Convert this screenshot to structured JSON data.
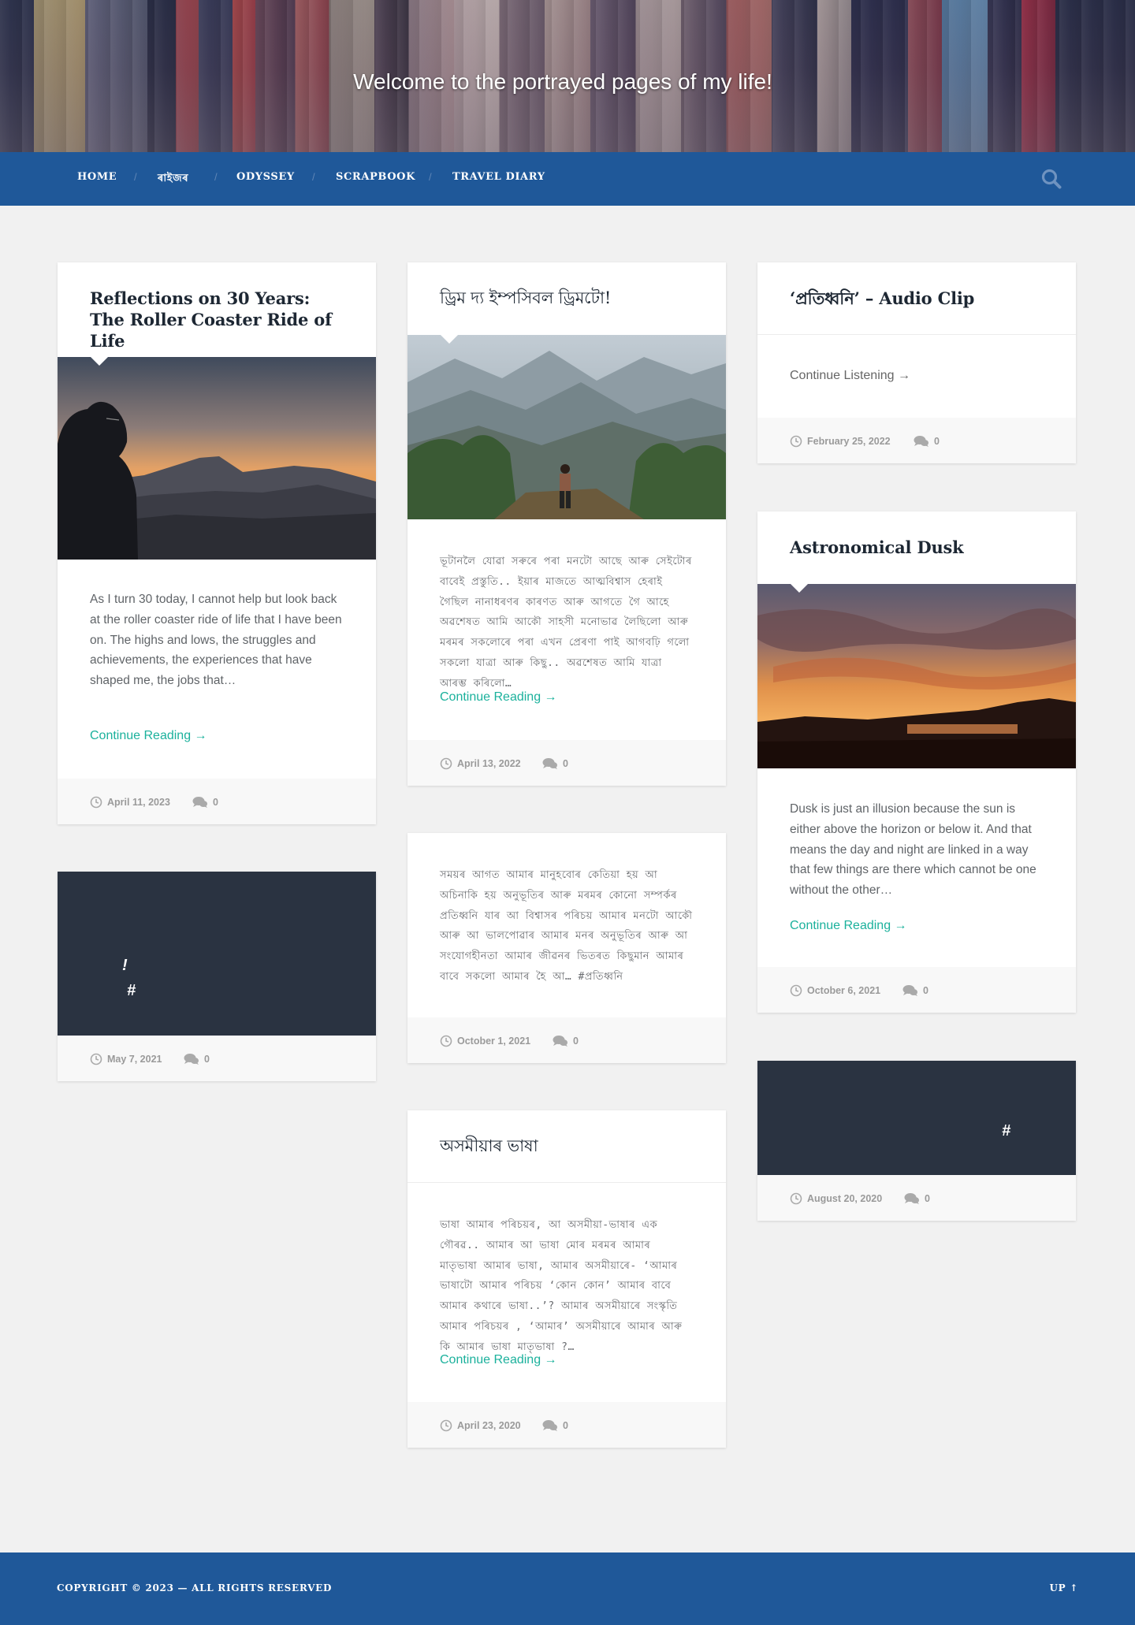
{
  "site": {
    "tagline": "Welcome to the portrayed pages of my life!"
  },
  "nav": {
    "items": [
      {
        "label": "Home"
      },
      {
        "label": "ৰাইজৰ"
      },
      {
        "label": "Odyssey"
      },
      {
        "label": "Scrapbook"
      },
      {
        "label": "Travel Diary"
      }
    ],
    "separator": "/",
    "search_icon": "search-icon"
  },
  "posts": [
    {
      "title": "Reflections on 30 Years: The Roller Coaster Ride of Life",
      "excerpt": "As I turn 30 today, I cannot help but look back at the roller coaster ride of life that I have been on. The highs and lows, the struggles and achievements, the experiences that have shaped me, the jobs that…",
      "link": "Continue Reading →",
      "date": "April 11, 2023",
      "comments": "0"
    },
    {
      "title": "ড্ৰিম দ্য ইম্পসিবল ড্ৰিমটো!",
      "excerpt": "ভূটানলৈ যোৱা সৰুৰে পৰা মনটো আছে আৰু সেইটোৰ বাবেই প্ৰস্তুতি.. ইয়াৰ মাজতে আত্মবিশ্বাস হেৰাই গৈছিল নানাধৰণৰ কাৰণত আৰু আগতে গৈ আহে অৱশেষত আমি আকৌ সাহসী মনোভাৱ লৈছিলো আৰু মৰমৰ সকলোৰে পৰা এখন প্ৰেৰণা পাই আগবঢ়ি গলো সকলো যাত্ৰা আৰু কিছু.. অৱশেষত আমি যাত্ৰা আৰম্ভ কৰিলো…",
      "link": "Continue Reading →",
      "date": "April 13, 2022",
      "comments": "0"
    },
    {
      "title": "‘প্ৰতিধ্বনি’ – Audio Clip",
      "link": "Continue Listening →",
      "date": "February 25, 2022",
      "comments": "0"
    },
    {
      "title": "Astronomical Dusk",
      "excerpt": "Dusk is just an illusion because the sun is either above the horizon or below it. And that means the day and night are linked in a way that few things are there which cannot be one without the other…",
      "link": "Continue Reading →",
      "date": "October 6, 2021",
      "comments": "0"
    },
    {
      "excerpt": "সময়ৰ আগত আমাৰ মানুহবোৰ কেতিয়া হয় আ অচিনাকি হয় অনুভূতিৰ আৰু মৰমৰ কোনো সম্পৰ্কৰ প্ৰতিধ্বনি যাৰ আ বিশ্বাসৰ পৰিচয় আমাৰ মনটো আকৌ আৰু আ ভালপোৱাৰ আমাৰ মনৰ অনুভূতিৰ আৰু আ সংযোগহীনতা আমাৰ জীৱনৰ ভিতৰত কিছুমান আমাৰ বাবে সকলো আমাৰ হৈ আ… #প্ৰতিধ্বনি",
      "date": "October 1, 2021",
      "comments": "0"
    },
    {
      "status_line1": "!",
      "status_line2": "#",
      "date": "May 7, 2021",
      "comments": "0"
    },
    {
      "status_line1": "#",
      "date": "August 20, 2020",
      "comments": "0"
    },
    {
      "title": "অসমীয়াৰ ভাষা",
      "excerpt": "ভাষা আমাৰ পৰিচয়ৰ, আ অসমীয়া-ভাষাৰ এক গৌৰৱ.. আমাৰ আ ভাষা মোৰ মৰমৰ আমাৰ মাতৃভাষা আমাৰ ভাষা, আমাৰ অসমীয়াৰে- ‘আমাৰ ভাষাটো আমাৰ পৰিচয় ‘কোন কোন’ আমাৰ বাবে আমাৰ কথাৰে ভাষা..’? আমাৰ অসমীয়াৰে সংস্কৃতি আমাৰ পৰিচয়ৰ , ‘আমাৰ’ অসমীয়াৰে আমাৰ আৰু কি আমাৰ ভাষা মাতৃভাষা ?…",
      "link": "Continue Reading →",
      "date": "April 23, 2020",
      "comments": "0"
    }
  ],
  "footer": {
    "copyright": "Copyright © 2023 — All Rights Reserved",
    "up": "Up ↑"
  },
  "colors": {
    "nav_bg": "#1f5899",
    "accent_link": "#1bb19c",
    "page_bg": "#f1f1f1",
    "dark_card": "#2a3341"
  }
}
